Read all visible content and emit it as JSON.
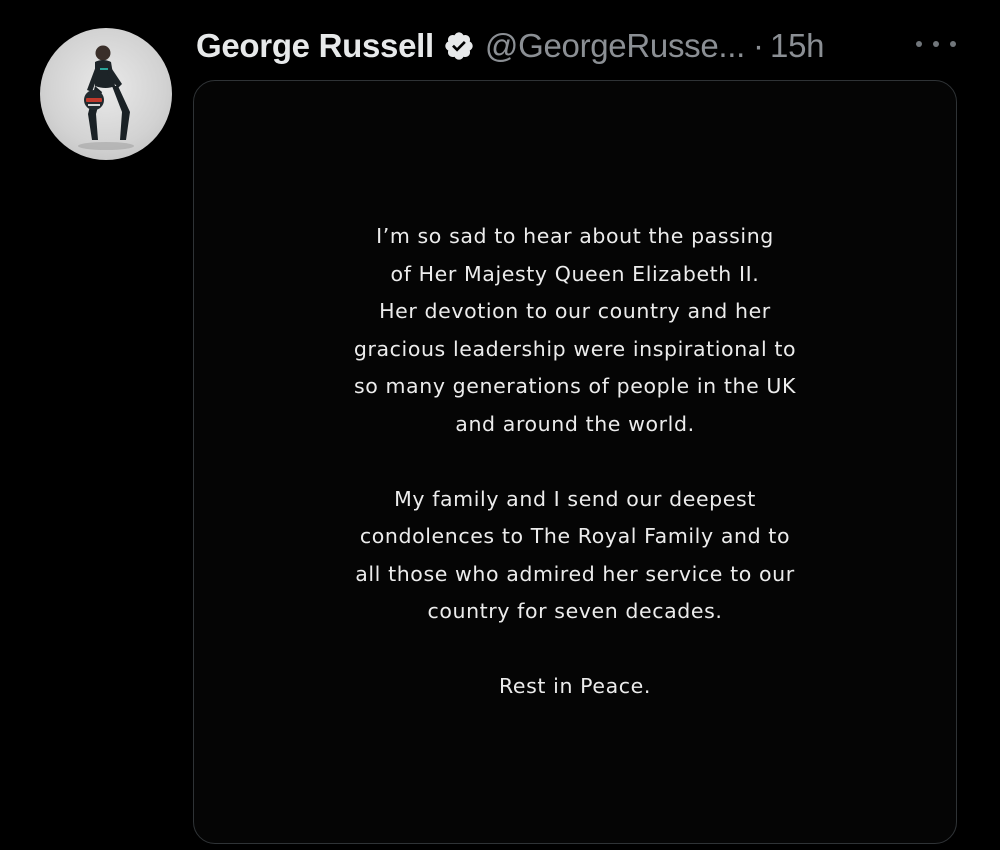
{
  "tweet": {
    "author": {
      "display_name": "George Russell",
      "handle": "@GeorgeRusse...",
      "verified": true
    },
    "separator": "·",
    "timestamp": "15h",
    "more_icon": "more-horizontal-icon",
    "media": {
      "paragraphs": [
        {
          "lines": [
            "I’m so sad to hear about the passing",
            "of Her Majesty Queen Elizabeth II.",
            "Her devotion to our country and her",
            "gracious leadership were inspirational to",
            "so many generations of people in the UK",
            "and around the world."
          ]
        },
        {
          "lines": [
            "My family and I send our deepest",
            "condolences to The Royal Family and to",
            "all those who admired her service to our",
            "country for seven decades."
          ]
        },
        {
          "lines": [
            "Rest in Peace."
          ]
        }
      ]
    }
  },
  "colors": {
    "background": "#000000",
    "text_primary": "#e7e9ea",
    "text_secondary": "#8b8f94",
    "border": "#2f3336"
  }
}
